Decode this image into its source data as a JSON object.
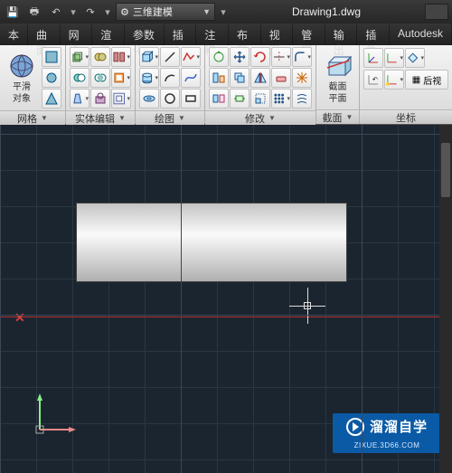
{
  "title": "Drawing1.dwg",
  "workspace": {
    "label": "三维建模"
  },
  "menu": {
    "items": [
      "本",
      "曲面",
      "网格",
      "渲染",
      "参数化",
      "插入",
      "注释",
      "布局",
      "视图",
      "管理",
      "输出",
      "插件",
      "Autodesk"
    ]
  },
  "ribbon": {
    "panels": [
      {
        "id": "mesh",
        "label": "网格",
        "big": {
          "label1": "平滑",
          "label2": "对象"
        }
      },
      {
        "id": "solided",
        "label": "实体编辑"
      },
      {
        "id": "draw",
        "label": "绘图"
      },
      {
        "id": "modify",
        "label": "修改"
      },
      {
        "id": "section",
        "label": "截面",
        "big": {
          "label1": "截面",
          "label2": "平面"
        }
      },
      {
        "id": "coord",
        "label": "坐标",
        "backview": "后视"
      }
    ]
  },
  "watermark": {
    "text": "溜溜自学",
    "sub": "ZIXUE.3D66.COM"
  },
  "colors": {
    "accent": "#0b5aa6",
    "canvas_bg": "#1b2530",
    "axis_x": "#b03030"
  }
}
